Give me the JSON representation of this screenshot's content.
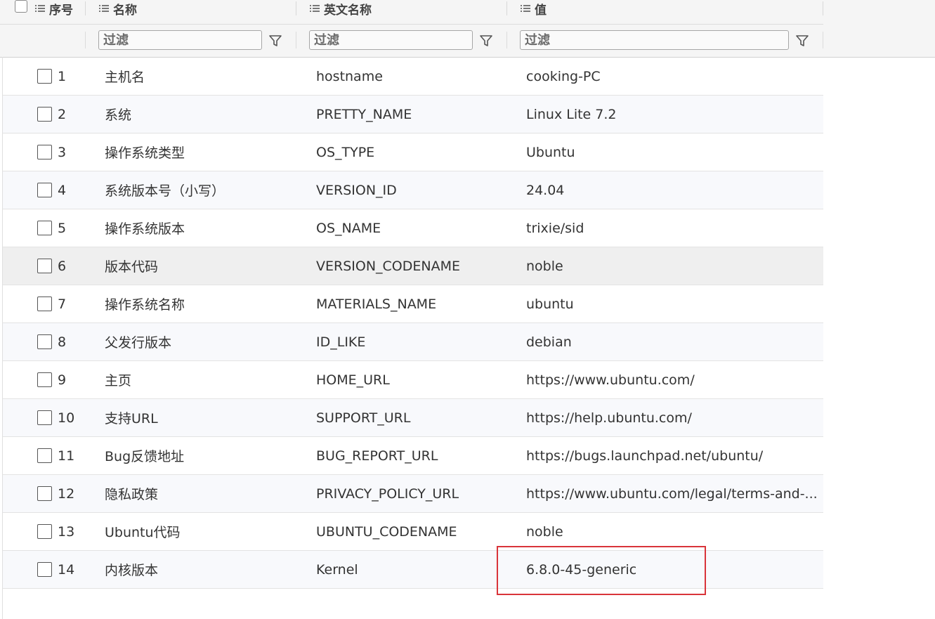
{
  "table": {
    "header": {
      "index": "序号",
      "name": "名称",
      "english_name": "英文名称",
      "value": "值"
    },
    "filter_placeholder": "过滤",
    "rows": [
      {
        "index": "1",
        "name": "主机名",
        "english_name": "hostname",
        "value": "cooking-PC"
      },
      {
        "index": "2",
        "name": "系统",
        "english_name": "PRETTY_NAME",
        "value": "Linux Lite 7.2"
      },
      {
        "index": "3",
        "name": "操作系统类型",
        "english_name": "OS_TYPE",
        "value": "Ubuntu"
      },
      {
        "index": "4",
        "name": "系统版本号（小写）",
        "english_name": "VERSION_ID",
        "value": "24.04"
      },
      {
        "index": "5",
        "name": "操作系统版本",
        "english_name": "OS_NAME",
        "value": "trixie/sid"
      },
      {
        "index": "6",
        "name": "版本代码",
        "english_name": "VERSION_CODENAME",
        "value": "noble"
      },
      {
        "index": "7",
        "name": "操作系统名称",
        "english_name": "MATERIALS_NAME",
        "value": "ubuntu"
      },
      {
        "index": "8",
        "name": "父发行版本",
        "english_name": "ID_LIKE",
        "value": "debian"
      },
      {
        "index": "9",
        "name": "主页",
        "english_name": "HOME_URL",
        "value": "https://www.ubuntu.com/"
      },
      {
        "index": "10",
        "name": "支持URL",
        "english_name": "SUPPORT_URL",
        "value": "https://help.ubuntu.com/"
      },
      {
        "index": "11",
        "name": "Bug反馈地址",
        "english_name": "BUG_REPORT_URL",
        "value": "https://bugs.launchpad.net/ubuntu/"
      },
      {
        "index": "12",
        "name": "隐私政策",
        "english_name": "PRIVACY_POLICY_URL",
        "value": "https://www.ubuntu.com/legal/terms-and-..."
      },
      {
        "index": "13",
        "name": "Ubuntu代码",
        "english_name": "UBUNTU_CODENAME",
        "value": "noble"
      },
      {
        "index": "14",
        "name": "内核版本",
        "english_name": "Kernel",
        "value": "6.8.0-45-generic"
      }
    ],
    "hovered_row": "6",
    "highlighted_cell": {
      "row": "14",
      "column": "value",
      "color": "#d9343a"
    }
  },
  "colors": {
    "header_bg": "#f5f5f5",
    "alt_row_bg": "#f8f9fc",
    "hover_row_bg": "#efefef",
    "highlight": "#d9343a"
  }
}
